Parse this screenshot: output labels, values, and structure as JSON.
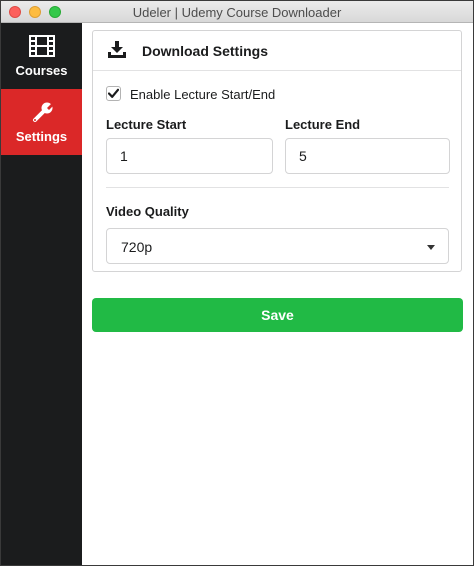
{
  "window": {
    "title": "Udeler | Udemy Course Downloader"
  },
  "sidebar": {
    "items": [
      {
        "label": "Courses",
        "icon": "film-icon",
        "active": false
      },
      {
        "label": "Settings",
        "icon": "wrench-icon",
        "active": true
      }
    ]
  },
  "panel": {
    "title": "Download Settings",
    "icon": "download-icon",
    "enable_lecture_range": {
      "label": "Enable Lecture Start/End",
      "checked": true
    },
    "lecture_start": {
      "label": "Lecture Start",
      "value": "1"
    },
    "lecture_end": {
      "label": "Lecture End",
      "value": "5"
    },
    "video_quality": {
      "label": "Video Quality",
      "value": "720p"
    }
  },
  "actions": {
    "save_label": "Save"
  },
  "colors": {
    "sidebar_bg": "#1b1c1d",
    "active_item": "#db2828",
    "save_button": "#21ba45"
  }
}
